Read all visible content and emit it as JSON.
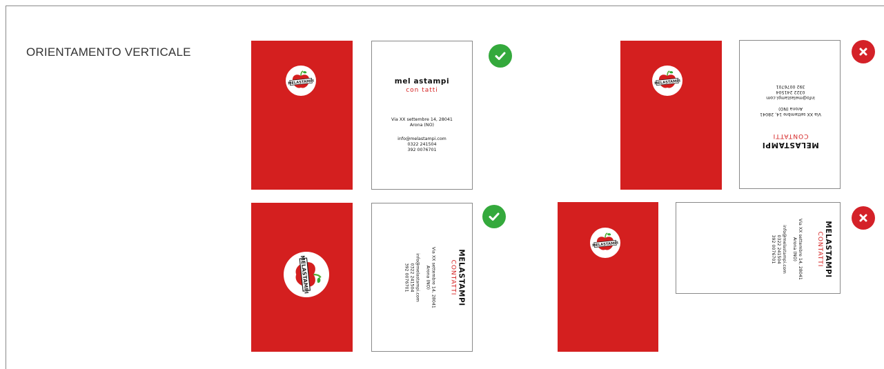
{
  "section_title": "ORIENTAMENTO VERTICALE",
  "card_text": {
    "brand_spaced": "mel astampi",
    "sub_spaced": "con tatti",
    "brand": "MELASTAMPI",
    "sub": "CONTATTI",
    "address_1": "Via XX settembre 14, 28041",
    "address_2": "Arona (NO)",
    "email": "info@melastampi.com",
    "phone_1": "0322 241504",
    "phone_2": "392 0076701",
    "logo_text": "MELASTAMPI"
  },
  "status": {
    "correct": "correct",
    "wrong": "wrong"
  },
  "colors": {
    "brand_red": "#d41f1f",
    "ok_green": "#34a93c",
    "ko_red": "#d42128"
  }
}
